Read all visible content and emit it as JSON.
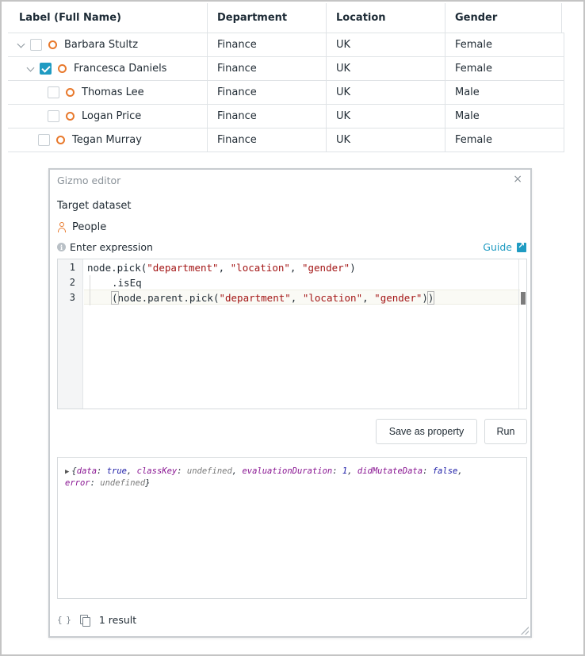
{
  "table": {
    "columns": [
      "Label (Full Name)",
      "Department",
      "Location",
      "Gender"
    ],
    "rows": [
      {
        "name": "Barbara Stultz",
        "department": "Finance",
        "location": "UK",
        "gender": "Female",
        "expanded": true,
        "checked": false
      },
      {
        "name": "Francesca Daniels",
        "department": "Finance",
        "location": "UK",
        "gender": "Female",
        "expanded": true,
        "checked": true
      },
      {
        "name": "Thomas Lee",
        "department": "Finance",
        "location": "UK",
        "gender": "Male",
        "checked": false
      },
      {
        "name": "Logan Price",
        "department": "Finance",
        "location": "UK",
        "gender": "Male",
        "checked": false
      },
      {
        "name": "Tegan Murray",
        "department": "Finance",
        "location": "UK",
        "gender": "Female",
        "checked": false
      }
    ]
  },
  "dialog": {
    "title": "Gizmo editor",
    "close": "×",
    "target_label": "Target dataset",
    "dataset": "People",
    "expression_label": "Enter expression",
    "guide": "Guide",
    "line_numbers": [
      "1",
      "2",
      "3"
    ],
    "code": {
      "l1_a": "node.pick(",
      "l1_s1": "\"department\"",
      "l1_c1": ", ",
      "l1_s2": "\"location\"",
      "l1_c2": ", ",
      "l1_s3": "\"gender\"",
      "l1_e": ")",
      "l2": ".isEq",
      "l3_a": "node.parent.pick(",
      "l3_s1": "\"department\"",
      "l3_c1": ", ",
      "l3_s2": "\"location\"",
      "l3_c2": ", ",
      "l3_s3": "\"gender\"",
      "l3_e": ")"
    },
    "buttons": {
      "save": "Save as property",
      "run": "Run"
    },
    "output": {
      "k1": "data",
      "v1": "true",
      "k2": "classKey",
      "v2": "undefined",
      "k3": "evaluationDuration",
      "v3": "1",
      "k4": "didMutateData",
      "v4": "false",
      "k5": "error",
      "v5": "undefined"
    },
    "footer": {
      "braces": "{ }",
      "result_count": "1 result"
    }
  }
}
